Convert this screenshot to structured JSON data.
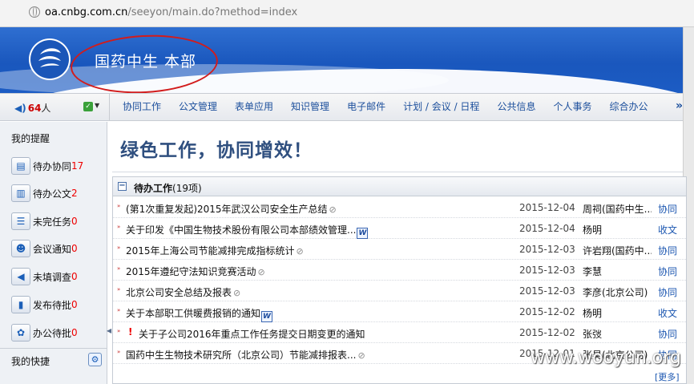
{
  "browser": {
    "url_host": "oa.cnbg.com.cn",
    "url_path": "/seeyon/main.do?method=index"
  },
  "header": {
    "brand": "国药中生  本部"
  },
  "toolbar": {
    "online_count": "64",
    "online_unit": "人"
  },
  "nav": {
    "items": [
      "协同工作",
      "公文管理",
      "表单应用",
      "知识管理",
      "电子邮件",
      "计划 / 会议 / 日程",
      "公共信息",
      "个人事务",
      "综合办公"
    ],
    "more": "»"
  },
  "sidebar": {
    "reminder_title": "我的提醒",
    "items": [
      {
        "label": "待办协同",
        "count": "17",
        "icon": "collab-icon"
      },
      {
        "label": "待办公文",
        "count": "2",
        "icon": "document-icon"
      },
      {
        "label": "未完任务",
        "count": "0",
        "icon": "task-icon"
      },
      {
        "label": "会议通知",
        "count": "0",
        "icon": "meeting-icon"
      },
      {
        "label": "未填调查",
        "count": "0",
        "icon": "survey-icon"
      },
      {
        "label": "发布待批",
        "count": "0",
        "icon": "chart-icon"
      },
      {
        "label": "办公待批",
        "count": "0",
        "icon": "office-icon"
      }
    ],
    "shortcut_title": "我的快捷"
  },
  "main": {
    "slogan": "绿色工作，协同增效！",
    "panel": {
      "title": "待办工作",
      "count": "(19项)",
      "more": "[更多]",
      "rows": [
        {
          "subject": "(第1次重复发起)2015年武汉公司安全生产总结",
          "date": "2015-12-04",
          "sender": "周祠(国药中生...",
          "type": "协同"
        },
        {
          "subject": "关于印发《中国生物技术股份有限公司本部绩效管理...",
          "date": "2015-12-04",
          "sender": "杨明",
          "type": "收文"
        },
        {
          "subject": "2015年上海公司节能减排完成指标统计",
          "date": "2015-12-03",
          "sender": "许岩翔(国药中...",
          "type": "协同"
        },
        {
          "subject": "2015年遵纪守法知识竞赛活动",
          "date": "2015-12-03",
          "sender": "李慧",
          "type": "协同"
        },
        {
          "subject": "北京公司安全总结及报表",
          "date": "2015-12-03",
          "sender": "李彦(北京公司)",
          "type": "协同"
        },
        {
          "subject": "关于本部职工供暖费报销的通知",
          "date": "2015-12-02",
          "sender": "杨明",
          "type": "收文"
        },
        {
          "subject": "关于子公司2016年重点工作任务提交日期变更的通知",
          "date": "2015-12-02",
          "sender": "张弢",
          "type": "协同"
        },
        {
          "subject": "国药中生生物技术研究所（北京公司）节能减排报表...",
          "date": "2015-12-01",
          "sender": "张昊(北京公司)",
          "type": "协同"
        }
      ]
    }
  },
  "watermark": "www.wooyun.org"
}
